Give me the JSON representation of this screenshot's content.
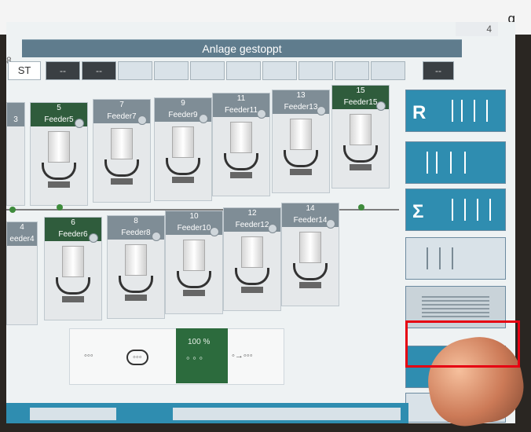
{
  "top": {
    "fragment": "g"
  },
  "screen": {
    "title": "Anlage gestoppt",
    "page_no": "4",
    "edge_left": "8"
  },
  "slots": {
    "first": "ST",
    "second": "--",
    "third": "--",
    "right": "--"
  },
  "feeders_top": [
    {
      "num": "",
      "name": "3"
    },
    {
      "num": "5",
      "name": "Feeder5"
    },
    {
      "num": "7",
      "name": "Feeder7"
    },
    {
      "num": "9",
      "name": "Feeder9"
    },
    {
      "num": "11",
      "name": "Feeder11"
    },
    {
      "num": "13",
      "name": "Feeder13"
    },
    {
      "num": "15",
      "name": "Feeder15"
    }
  ],
  "feeders_bottom": [
    {
      "num": "4",
      "name": "eeder4"
    },
    {
      "num": "6",
      "name": "Feeder6"
    },
    {
      "num": "8",
      "name": "Feeder8"
    },
    {
      "num": "10",
      "name": "Feeder10"
    },
    {
      "num": "12",
      "name": "Feeder12"
    },
    {
      "num": "14",
      "name": "Feeder14"
    }
  ],
  "mode": {
    "active_text": "100 %"
  },
  "right_tiles": [
    {
      "label": "R"
    },
    {
      "label": ""
    },
    {
      "label": ""
    },
    {
      "label": ""
    },
    {
      "label": ""
    },
    {
      "label": ""
    }
  ]
}
